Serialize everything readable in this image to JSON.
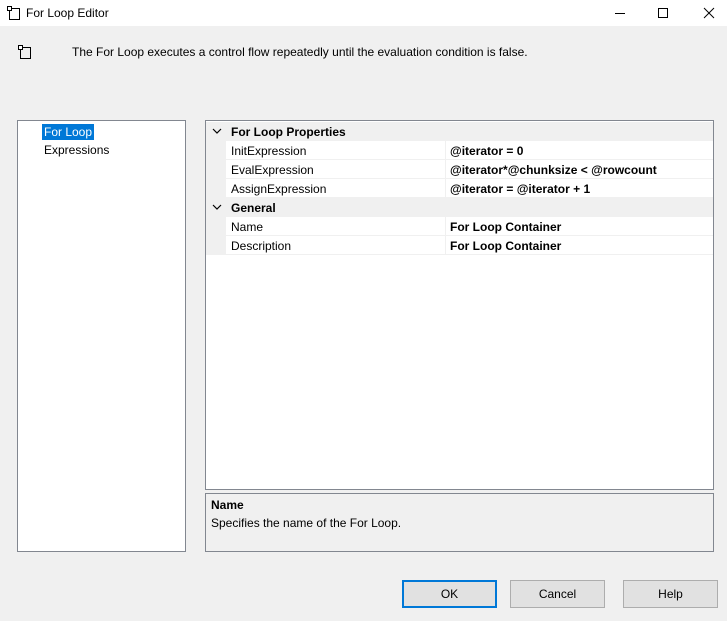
{
  "window": {
    "title": "For Loop Editor",
    "description": "The For Loop executes a control flow repeatedly until the evaluation condition is false."
  },
  "nav": {
    "items": [
      {
        "label": "For Loop",
        "selected": true
      },
      {
        "label": "Expressions",
        "selected": false
      }
    ]
  },
  "properties": {
    "categories": [
      {
        "label": "For Loop Properties",
        "rows": [
          {
            "name": "InitExpression",
            "value": "@iterator = 0"
          },
          {
            "name": "EvalExpression",
            "value": "@iterator*@chunksize < @rowcount"
          },
          {
            "name": "AssignExpression",
            "value": "@iterator = @iterator + 1"
          }
        ]
      },
      {
        "label": "General",
        "rows": [
          {
            "name": "Name",
            "value": "For Loop Container"
          },
          {
            "name": "Description",
            "value": "For Loop Container"
          }
        ]
      }
    ]
  },
  "help": {
    "title": "Name",
    "text": "Specifies the name of the For Loop."
  },
  "buttons": {
    "ok": "OK",
    "cancel": "Cancel",
    "help": "Help"
  },
  "colors": {
    "selection": "#0078d7",
    "window_bg": "#f0f0f0"
  }
}
